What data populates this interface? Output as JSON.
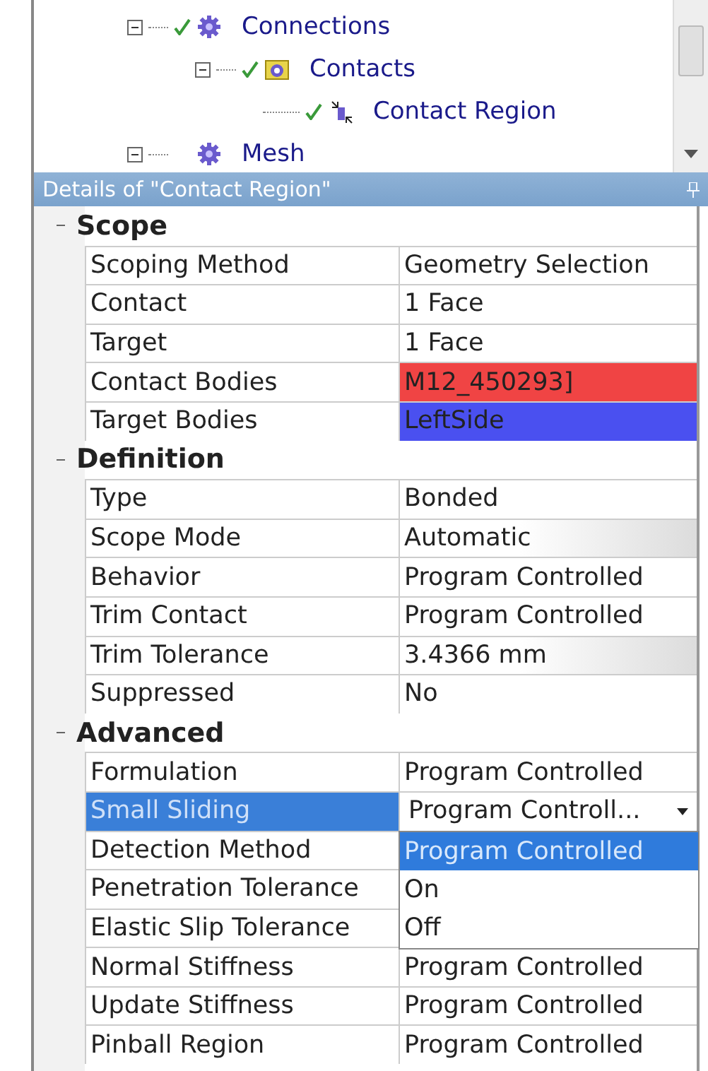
{
  "tree": [
    {
      "label": "Connections",
      "expanded": true,
      "checked": true,
      "children": [
        {
          "label": "Contacts",
          "expanded": true,
          "checked": true,
          "children": [
            {
              "label": "Contact Region",
              "checked": true
            }
          ]
        }
      ]
    },
    {
      "label": "Mesh",
      "expanded": true,
      "checked": false
    }
  ],
  "details": {
    "title": "Details of \"Contact Region\"",
    "sections": [
      {
        "title": "Scope",
        "expanded": true,
        "rows": [
          {
            "name": "Scoping Method",
            "value": "Geometry Selection",
            "kind": "text",
            "selected": false
          },
          {
            "name": "Contact",
            "value": "1 Face",
            "kind": "text",
            "selected": false
          },
          {
            "name": "Target",
            "value": "1 Face",
            "kind": "text",
            "selected": false
          },
          {
            "name": "Contact Bodies",
            "value": "M12_450293]",
            "kind": "color",
            "color": "#f04444",
            "selected": false
          },
          {
            "name": "Target Bodies",
            "value": "LeftSide",
            "kind": "color",
            "color": "#4a50f0",
            "selected": false
          }
        ]
      },
      {
        "title": "Definition",
        "expanded": true,
        "rows": [
          {
            "name": "Type",
            "value": "Bonded",
            "kind": "text",
            "selected": false
          },
          {
            "name": "Scope Mode",
            "value": "Automatic",
            "kind": "readonly",
            "selected": false
          },
          {
            "name": "Behavior",
            "value": "Program Controlled",
            "kind": "text",
            "selected": false
          },
          {
            "name": "Trim Contact",
            "value": "Program Controlled",
            "kind": "text",
            "selected": false
          },
          {
            "name": "Trim Tolerance",
            "value": "3.4366 mm",
            "kind": "readonly",
            "selected": false
          },
          {
            "name": "Suppressed",
            "value": "No",
            "kind": "text",
            "selected": false
          }
        ]
      },
      {
        "title": "Advanced",
        "expanded": true,
        "rows": [
          {
            "name": "Formulation",
            "value": "Program Controlled",
            "kind": "text",
            "selected": false
          },
          {
            "name": "Small Sliding",
            "value": "Program Controll...",
            "kind": "dropdown",
            "selected": true,
            "options": [
              {
                "label": "Program Controlled",
                "selected": true
              },
              {
                "label": "On",
                "selected": false
              },
              {
                "label": "Off",
                "selected": false
              }
            ]
          },
          {
            "name": "Detection Method",
            "kind": "hidden",
            "selected": false
          },
          {
            "name": "Penetration Tolerance",
            "kind": "hidden",
            "selected": false
          },
          {
            "name": "Elastic Slip Tolerance",
            "kind": "hidden",
            "selected": false
          },
          {
            "name": "Normal Stiffness",
            "value": "Program Controlled",
            "kind": "text",
            "selected": false
          },
          {
            "name": "Update Stiffness",
            "value": "Program Controlled",
            "kind": "text",
            "selected": false
          },
          {
            "name": "Pinball Region",
            "value": "Program Controlled",
            "kind": "text",
            "selected": false
          }
        ]
      }
    ]
  }
}
